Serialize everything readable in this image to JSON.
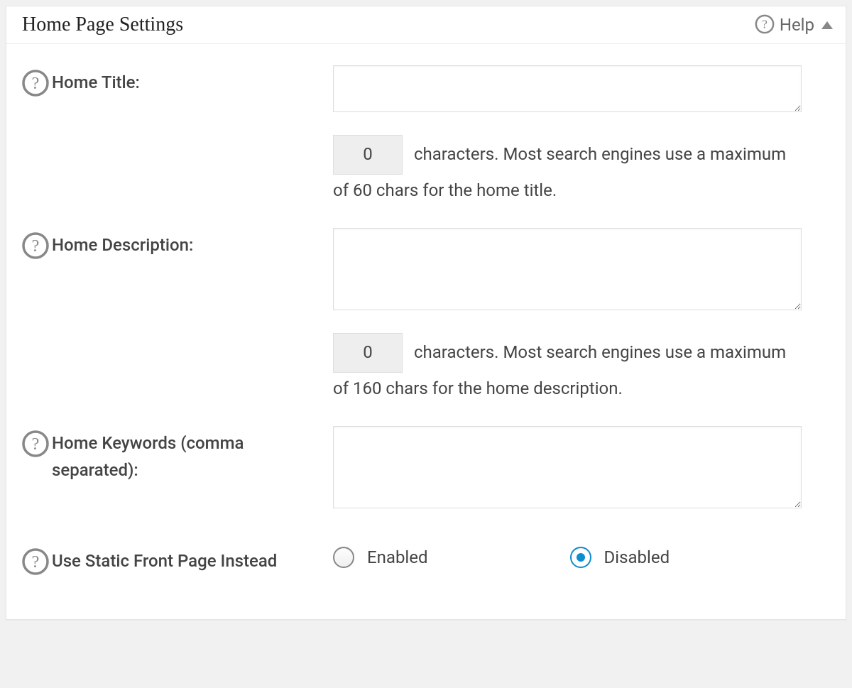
{
  "header": {
    "title": "Home Page Settings",
    "help_label": "Help"
  },
  "fields": {
    "home_title": {
      "label": "Home Title:",
      "value": "",
      "count": "0",
      "count_info": " characters. Most search engines use a maximum of 60 chars for the home title."
    },
    "home_description": {
      "label": "Home Description:",
      "value": "",
      "count": "0",
      "count_info": " characters. Most search engines use a maximum of 160 chars for the home description."
    },
    "home_keywords": {
      "label": "Home Keywords (comma separated):",
      "value": ""
    },
    "static_front_page": {
      "label": "Use Static Front Page Instead",
      "option_enabled": "Enabled",
      "option_disabled": "Disabled",
      "selected": "disabled"
    }
  }
}
